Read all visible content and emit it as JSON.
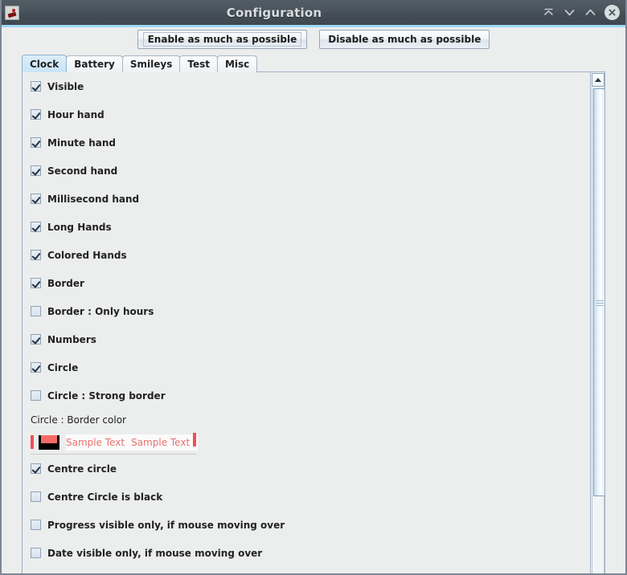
{
  "window": {
    "title": "Configuration",
    "app_icon": "app-icon",
    "controls": [
      {
        "name": "shade-window-button",
        "icon": "collapse-up-icon"
      },
      {
        "name": "minimize-button",
        "icon": "chevron-down-icon"
      },
      {
        "name": "maximize-button",
        "icon": "chevron-up-icon"
      },
      {
        "name": "close-button",
        "icon": "close-x-icon"
      }
    ],
    "title_bar_color": "#49535b",
    "accent_color": "#9ed9f5"
  },
  "toolbar": {
    "enable_label": "Enable as much as possible",
    "disable_label": "Disable as much as possible"
  },
  "tabs": [
    {
      "label": "Clock",
      "active": true
    },
    {
      "label": "Battery",
      "active": false
    },
    {
      "label": "Smileys",
      "active": false
    },
    {
      "label": "Test",
      "active": false
    },
    {
      "label": "Misc",
      "active": false
    }
  ],
  "clock_panel": {
    "options_top": [
      {
        "label": "Visible",
        "checked": true
      },
      {
        "label": "Hour hand",
        "checked": true
      },
      {
        "label": "Minute hand",
        "checked": true
      },
      {
        "label": "Second hand",
        "checked": true
      },
      {
        "label": "Millisecond hand",
        "checked": true
      },
      {
        "label": "Long Hands",
        "checked": true
      },
      {
        "label": "Colored Hands",
        "checked": true
      },
      {
        "label": "Border",
        "checked": true
      },
      {
        "label": "Border : Only hours",
        "checked": false
      },
      {
        "label": "Numbers",
        "checked": true
      },
      {
        "label": "Circle",
        "checked": true
      },
      {
        "label": "Circle : Strong border",
        "checked": false
      }
    ],
    "color_section": {
      "label": "Circle : Border color",
      "swatch_color": "#f86a66",
      "swatch_frame_color": "#000000",
      "caret_color": "#ef4f55",
      "sample_text_color": "#e8706e",
      "sample_text_1": "Sample Text",
      "sample_text_2": "Sample Text"
    },
    "options_bottom": [
      {
        "label": "Centre circle",
        "checked": true
      },
      {
        "label": "Centre Circle is black",
        "checked": false
      },
      {
        "label": "Progress visible only, if mouse moving over",
        "checked": false
      },
      {
        "label": "Date visible only, if mouse moving over",
        "checked": false
      }
    ]
  },
  "scrollbar": {
    "up_arrow": "scroll-up-arrow-icon",
    "thumb": "scroll-thumb"
  }
}
